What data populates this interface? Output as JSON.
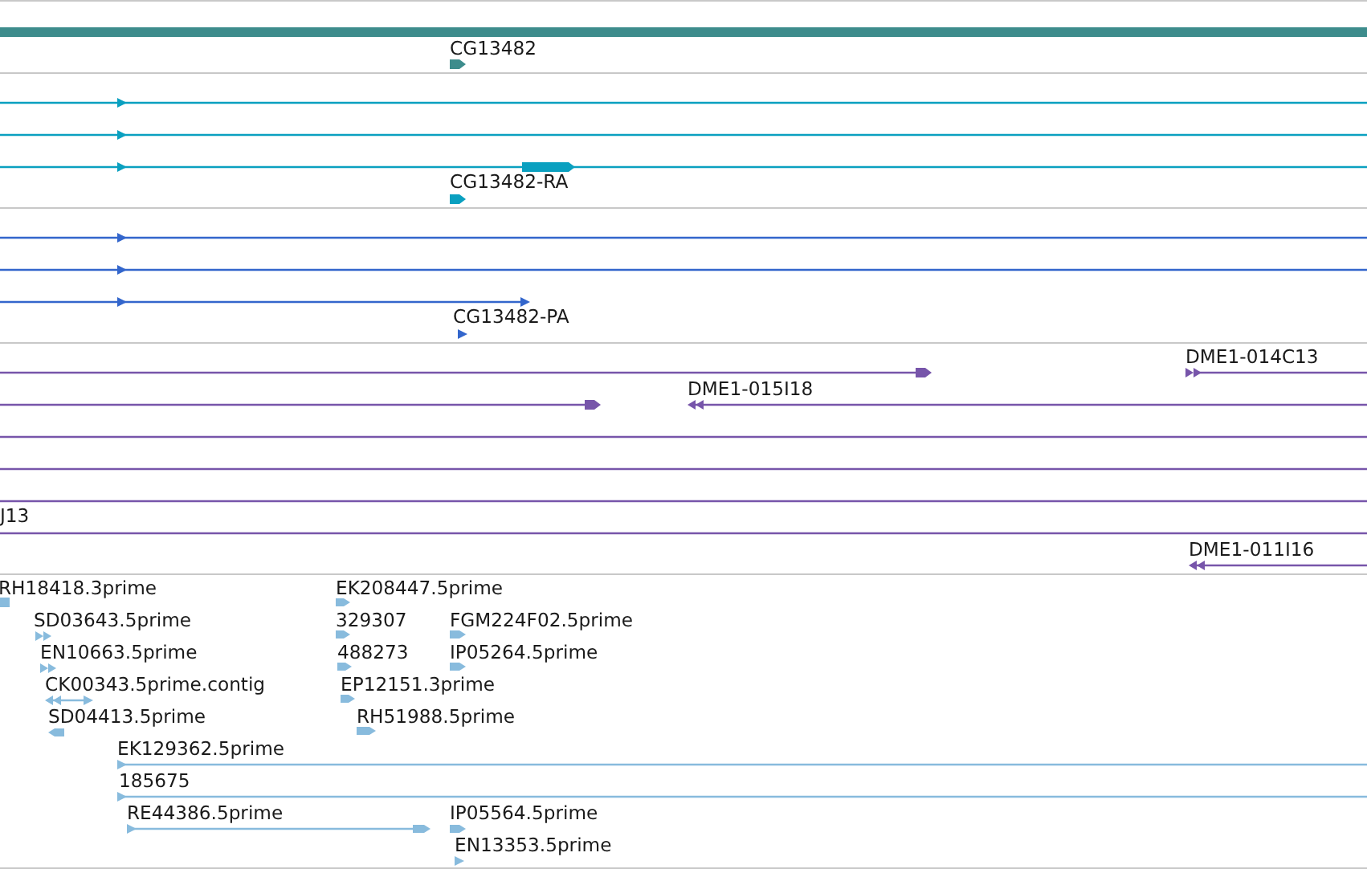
{
  "tracks": [
    {
      "kind": "gene",
      "color": "#3d8c8c",
      "labels": [
        "CG13482"
      ]
    },
    {
      "kind": "transcript",
      "color": "#0aa0c0",
      "labels": [
        "CG13482-RA"
      ]
    },
    {
      "kind": "protein",
      "color": "#3366cc",
      "labels": [
        "CG13482-PA"
      ]
    },
    {
      "kind": "clone",
      "color": "#7755aa",
      "labels": [
        "DME1-014C13",
        "DME1-015I18",
        "J13",
        "DME1-011I16"
      ]
    },
    {
      "kind": "est",
      "color": "#88bbdd",
      "labels": [
        "RH18418.3prime",
        "SD03643.5prime",
        "EN10663.5prime",
        "CK00343.5prime.contig",
        "SD04413.5prime",
        "EK129362.5prime",
        "185675",
        "RE44386.5prime",
        "EK208447.5prime",
        "329307",
        "488273",
        "EP12151.3prime",
        "RH51988.5prime",
        "FGM224F02.5prime",
        "IP05264.5prime",
        "IP05564.5prime",
        "EN13353.5prime"
      ]
    }
  ]
}
